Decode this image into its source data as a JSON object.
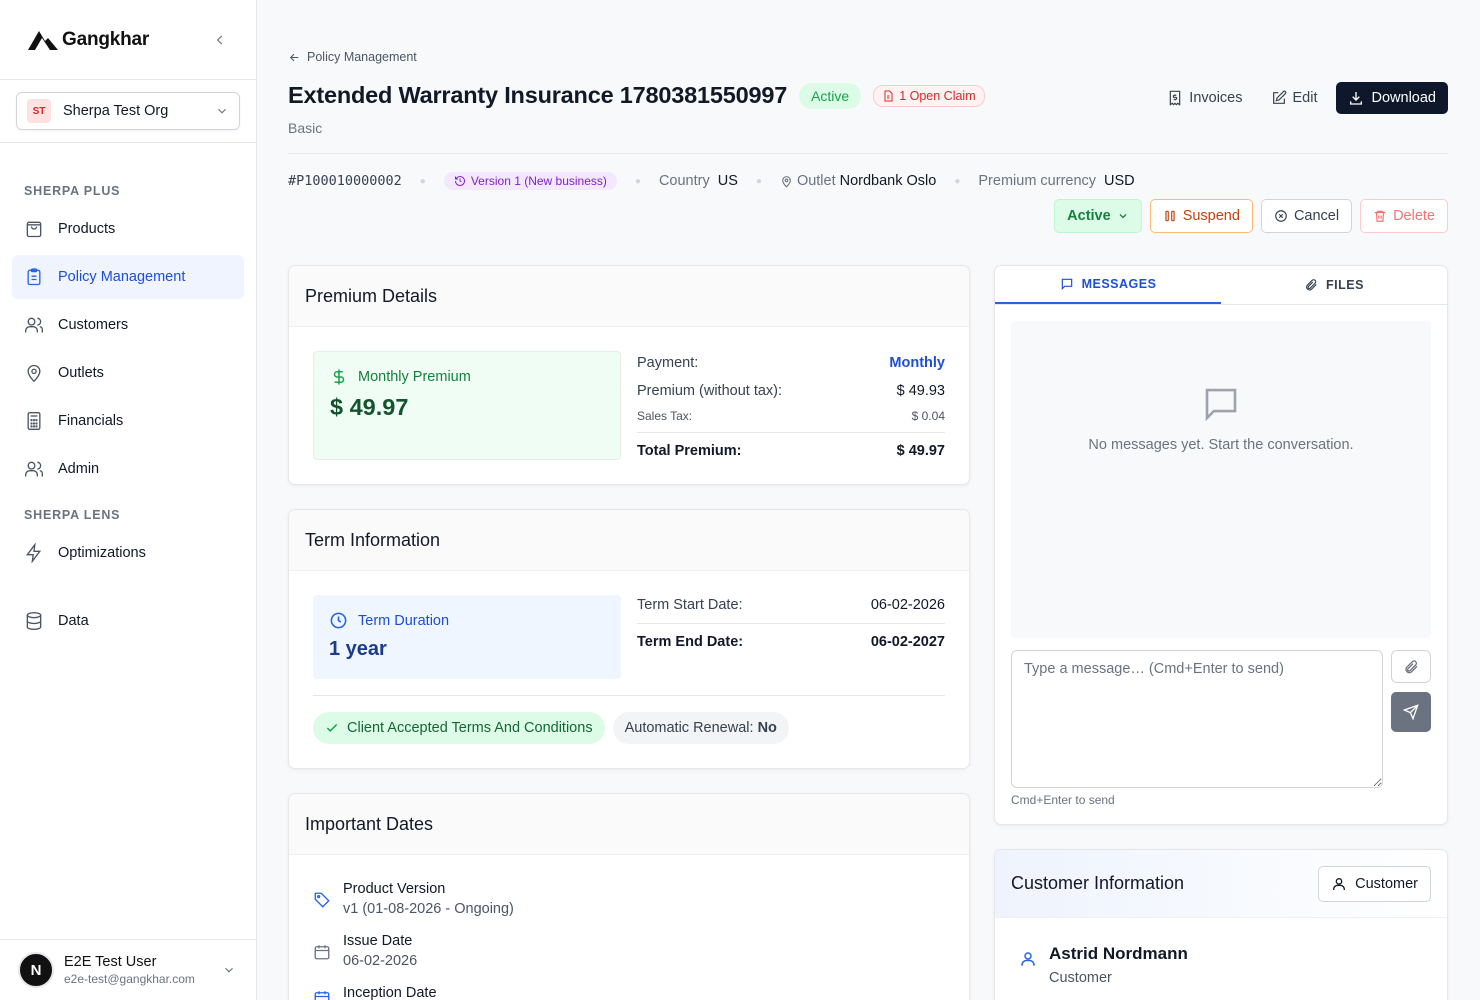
{
  "app": {
    "brand": "Gangkhar"
  },
  "sidebar": {
    "org": {
      "initials": "ST",
      "name": "Sherpa Test Org"
    },
    "sections": [
      {
        "heading": "SHERPA PLUS"
      },
      {
        "heading": "SHERPA LENS"
      }
    ],
    "items": [
      {
        "label": "Products",
        "icon": "shopping-bag-icon"
      },
      {
        "label": "Policy Management",
        "icon": "clipboard-icon",
        "active": true
      },
      {
        "label": "Customers",
        "icon": "users-icon"
      },
      {
        "label": "Outlets",
        "icon": "map-pin-icon"
      },
      {
        "label": "Financials",
        "icon": "calculator-icon"
      },
      {
        "label": "Admin",
        "icon": "users-icon"
      },
      {
        "label": "Optimizations",
        "icon": "zap-icon"
      },
      {
        "label": "Data",
        "icon": "database-icon"
      }
    ],
    "user": {
      "initial": "N",
      "name": "E2E Test User",
      "email": "e2e-test@gangkhar.com"
    }
  },
  "header": {
    "breadcrumb": "Policy Management",
    "title": "Extended Warranty Insurance 1780381550997",
    "status_badge": "Active",
    "claim_badge": "1 Open Claim",
    "subtitle": "Basic",
    "actions": {
      "invoices": "Invoices",
      "edit": "Edit",
      "download": "Download"
    }
  },
  "meta": {
    "policy_number": "#P100010000002",
    "version": "Version 1 (New business)",
    "country_label": "Country",
    "country_value": "US",
    "outlet_label": "Outlet",
    "outlet_value": "Nordbank Oslo",
    "currency_label": "Premium currency",
    "currency_value": "USD"
  },
  "status_actions": {
    "status": "Active",
    "suspend": "Suspend",
    "cancel": "Cancel",
    "delete": "Delete"
  },
  "premium": {
    "title": "Premium Details",
    "box_label": "Monthly Premium",
    "box_value": "$ 49.97",
    "payment_label": "Payment:",
    "payment_value": "Monthly",
    "premium_label": "Premium (without tax):",
    "premium_value": "$ 49.93",
    "tax_label": "Sales Tax:",
    "tax_value": "$ 0.04",
    "total_label": "Total Premium:",
    "total_value": "$ 49.97"
  },
  "term": {
    "title": "Term Information",
    "box_label": "Term Duration",
    "box_value": "1 year",
    "start_label": "Term Start Date:",
    "start_value": "06-02-2026",
    "end_label": "Term End Date:",
    "end_value": "06-02-2027",
    "accepted": "Client Accepted Terms And Conditions",
    "renewal_label": "Automatic Renewal:",
    "renewal_value": "No"
  },
  "dates": {
    "title": "Important Dates",
    "items": [
      {
        "title": "Product Version",
        "value": "v1 (01-08-2026 - Ongoing)"
      },
      {
        "title": "Issue Date",
        "value": "06-02-2026"
      },
      {
        "title": "Inception Date",
        "value": ""
      }
    ]
  },
  "messages": {
    "tabs": [
      "MESSAGES",
      "FILES"
    ],
    "empty": "No messages yet. Start the conversation.",
    "placeholder": "Type a message… (Cmd+Enter to send)",
    "hint": "Cmd+Enter to send"
  },
  "customer": {
    "title": "Customer Information",
    "button": "Customer",
    "name": "Astrid Nordmann",
    "role": "Customer"
  },
  "colors": {
    "primary": "#0f172a",
    "accent": "#2563eb",
    "success": "#16a34a",
    "danger": "#dc2626",
    "warning": "#c2410c"
  }
}
